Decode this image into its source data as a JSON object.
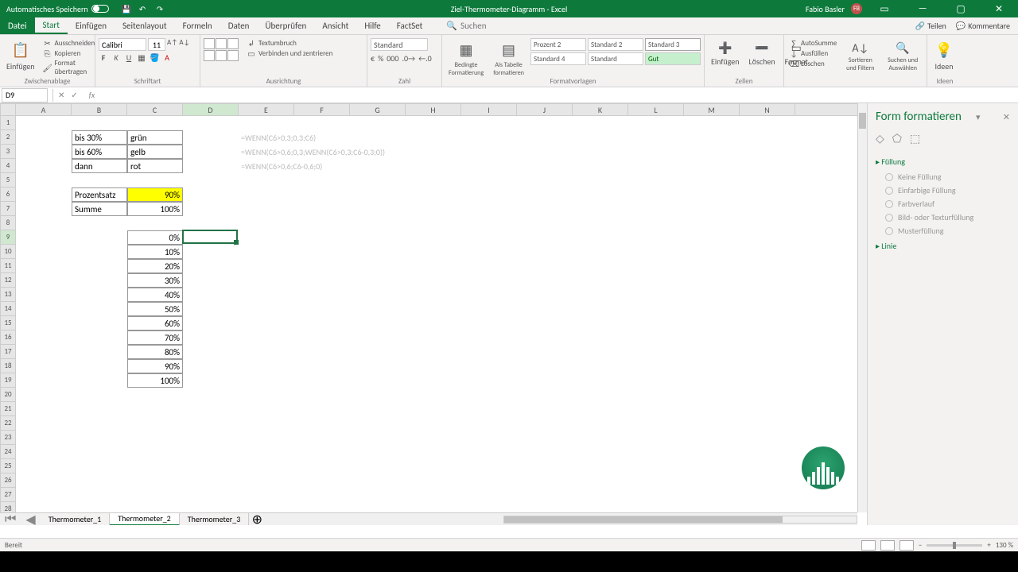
{
  "title_bar": {
    "auto_save_label": "Automatisches Speichern",
    "doc_title": "Ziel-Thermometer-Diagramm - Excel",
    "user_name": "Fabio Basler",
    "user_initials": "FB"
  },
  "menu": {
    "tabs": [
      "Datei",
      "Start",
      "Einfügen",
      "Seitenlayout",
      "Formeln",
      "Daten",
      "Überprüfen",
      "Ansicht",
      "Hilfe",
      "FactSet"
    ],
    "active_index": 1,
    "search_placeholder": "Suchen",
    "share": "Teilen",
    "comments": "Kommentare"
  },
  "ribbon": {
    "clipboard": {
      "label": "Zwischenablage",
      "paste": "Einfügen",
      "cut": "Ausschneiden",
      "copy": "Kopieren",
      "format_painter": "Format übertragen"
    },
    "font": {
      "label": "Schriftart",
      "name": "Calibri",
      "size": "11",
      "b": "F",
      "i": "K",
      "u": "U"
    },
    "align": {
      "label": "Ausrichtung",
      "wrap": "Textumbruch",
      "merge": "Verbinden und zentrieren"
    },
    "number": {
      "label": "Zahl",
      "format": "Standard"
    },
    "styles": {
      "label": "Formatvorlagen",
      "cond": "Bedingte Formatierung",
      "table": "Als Tabelle formatieren",
      "s1": "Prozent 2",
      "s2": "Standard 2",
      "s3": "Standard 3",
      "s4": "Standard 4",
      "s5": "Standard",
      "s6": "Gut"
    },
    "cells": {
      "label": "Zellen",
      "insert": "Einfügen",
      "delete": "Löschen",
      "format": "Format"
    },
    "editing": {
      "label": "",
      "sum": "AutoSumme",
      "fill": "Ausfüllen",
      "clear": "Löschen",
      "sort": "Sortieren und Filtern",
      "find": "Suchen und Auswählen"
    },
    "ideas": {
      "label": "Ideen",
      "btn": "Ideen"
    }
  },
  "formula_bar": {
    "name_box": "D9",
    "formula": ""
  },
  "columns": [
    "A",
    "B",
    "C",
    "D",
    "E",
    "F",
    "G",
    "H",
    "I",
    "J",
    "K",
    "L",
    "M",
    "N"
  ],
  "active_col_index": 3,
  "active_row": 9,
  "row_count": 28,
  "cells": {
    "B2": "bis 30%",
    "C2": "grün",
    "E2": "=WENN(C6>0,3;0,3;C6)",
    "B3": "bis 60%",
    "C3": "gelb",
    "E3": "=WENN(C6>0,6;0,3;WENN(C6>0,3;C6-0,3;0))",
    "B4": "dann",
    "C4": "rot",
    "E4": "=WENN(C6>0,6;C6-0,6;0)",
    "B6": "Prozentsatz",
    "C6": "90%",
    "B7": "Summe",
    "C7": "100%",
    "C9": "0%",
    "C10": "10%",
    "C11": "20%",
    "C12": "30%",
    "C13": "40%",
    "C14": "50%",
    "C15": "60%",
    "C16": "70%",
    "C17": "80%",
    "C18": "90%",
    "C19": "100%"
  },
  "sheet_tabs": {
    "tabs": [
      "Thermometer_1",
      "Thermometer_2",
      "Thermometer_3"
    ],
    "active_index": 1
  },
  "task_pane": {
    "title": "Form formatieren",
    "sections": {
      "fill": "Füllung",
      "line": "Linie"
    },
    "fill_options": [
      "Keine Füllung",
      "Einfarbige Füllung",
      "Farbverlauf",
      "Bild- oder Texturfüllung",
      "Musterfüllung"
    ]
  },
  "status": {
    "ready": "Bereit",
    "zoom": "130 %"
  }
}
